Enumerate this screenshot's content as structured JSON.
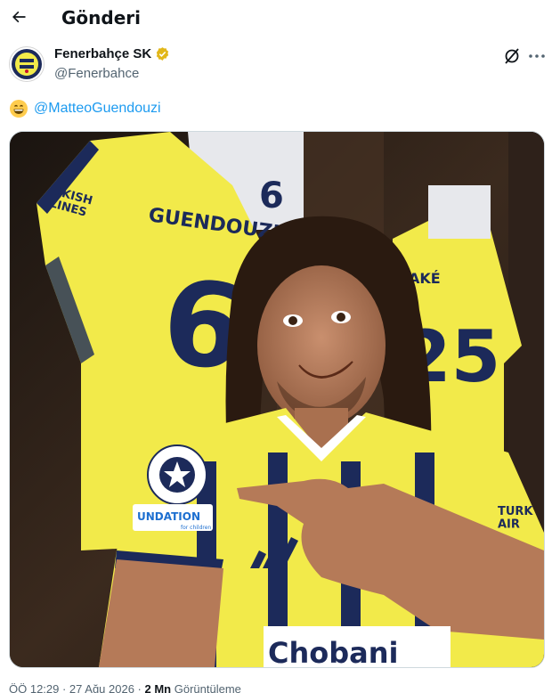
{
  "header": {
    "title": "Gönderi"
  },
  "author": {
    "name": "Fenerbahçe SK",
    "handle": "@Fenerbahce"
  },
  "tweet": {
    "mention": "@MatteoGuendouzi",
    "image": {
      "jersey_left_name": "GUENDOUZI",
      "jersey_left_number": "6",
      "jersey_top_number": "6",
      "jersey_right_name": "AKÉ",
      "jersey_right_number": "25",
      "sponsor_left": "RKISH\nLINES",
      "sponsor_front": "Chobani",
      "sleeve_badge": "UNDATION",
      "sleeve_badge_sub": "for children",
      "right_sleeve": "TURK\nAIR"
    }
  },
  "meta": {
    "time": "ÖÖ 12:29 · 27 Ağu 2026 · ",
    "views_count": "2 Mn",
    "views_label": " Görüntüleme"
  },
  "colors": {
    "accent": "#1d9bf0",
    "verified_gold": "#e2b719",
    "jersey_yellow": "#f2ea4a",
    "jersey_navy": "#1c2a5a"
  }
}
